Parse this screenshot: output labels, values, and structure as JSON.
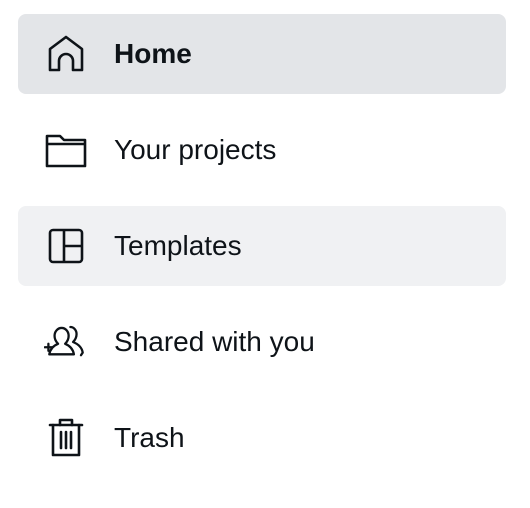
{
  "sidebar": {
    "items": [
      {
        "label": "Home",
        "icon": "home-icon",
        "state": "active"
      },
      {
        "label": "Your projects",
        "icon": "folder-icon",
        "state": "default"
      },
      {
        "label": "Templates",
        "icon": "templates-icon",
        "state": "hover"
      },
      {
        "label": "Shared with you",
        "icon": "shared-users-icon",
        "state": "default"
      },
      {
        "label": "Trash",
        "icon": "trash-icon",
        "state": "default"
      }
    ]
  },
  "colors": {
    "active_bg": "#e3e5e8",
    "hover_bg": "#f0f1f3",
    "text": "#0e1318"
  }
}
